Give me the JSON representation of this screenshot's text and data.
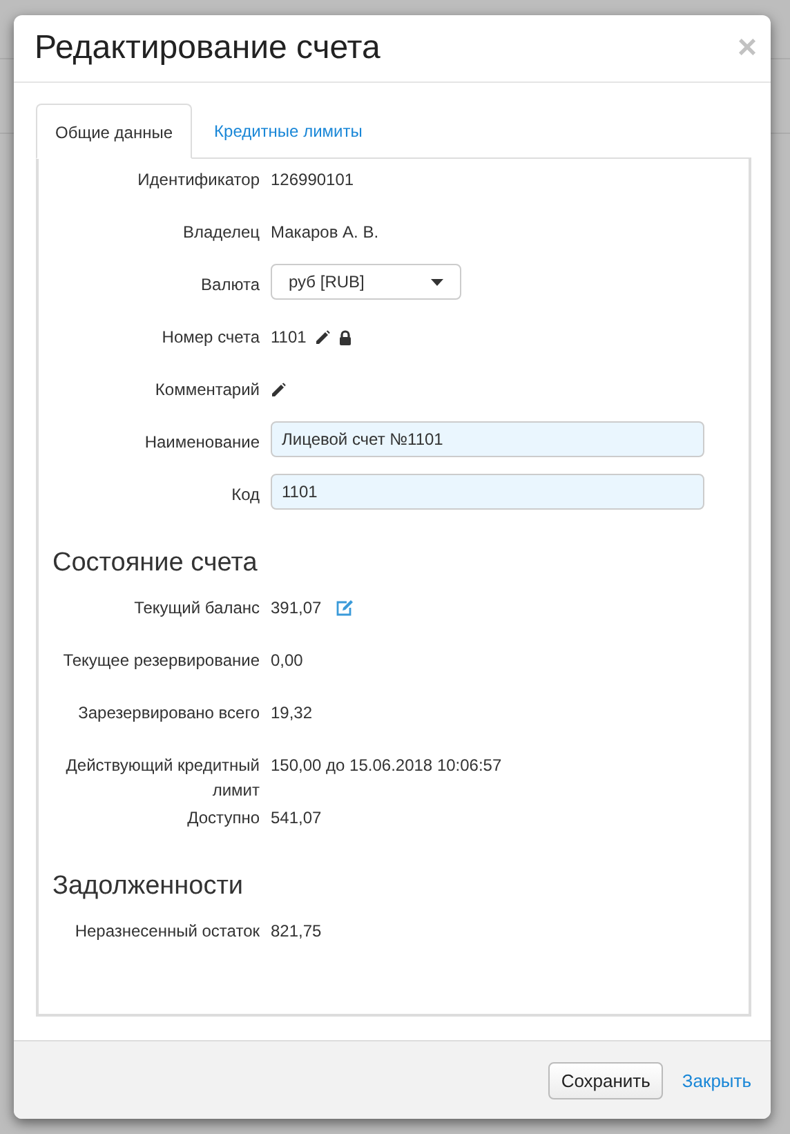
{
  "window": {
    "title": "Редактирование счета",
    "close": "×"
  },
  "tabs": [
    {
      "label": "Общие данные",
      "selected": true
    },
    {
      "label": "Кредитные лимиты",
      "selected": false
    }
  ],
  "sections": [
    {
      "rows": [
        {
          "label": "Идентификатор",
          "kind": "text",
          "value": "126990101"
        },
        {
          "label": "Владелец",
          "kind": "text",
          "value": "Макаров А. В."
        },
        {
          "label": "Валюта",
          "kind": "select",
          "value": "руб [RUB]"
        },
        {
          "label": "Номер счета",
          "kind": "locked",
          "value": "1101"
        },
        {
          "label": "Комментарий",
          "kind": "editable"
        },
        {
          "label": "Наименование",
          "kind": "input",
          "value": "Лицевой счет №1101"
        },
        {
          "label": "Код",
          "kind": "input",
          "value": "1101"
        }
      ]
    },
    {
      "heading": "Состояние счета",
      "rows": [
        {
          "label": "Текущий баланс",
          "kind": "adjustable",
          "value": "391,07"
        },
        {
          "label": "Текущее резервирование",
          "kind": "text",
          "value": "0,00"
        },
        {
          "label": "Зарезервировано всего",
          "kind": "text",
          "value": "19,32"
        },
        {
          "label": "Действующий кредитный лимит",
          "kind": "text",
          "value": "150,00 до 15.06.2018 10:06:57"
        },
        {
          "label": "Доступно",
          "kind": "text",
          "value": "541,07"
        }
      ]
    },
    {
      "heading": "Задолженности",
      "rows": [
        {
          "label": "Неразнесенный остаток",
          "kind": "text",
          "value": "821,75"
        }
      ]
    }
  ],
  "buttons": [
    {
      "label": "Сохранить",
      "kind": "default"
    },
    {
      "label": "Закрыть",
      "kind": "link"
    }
  ]
}
